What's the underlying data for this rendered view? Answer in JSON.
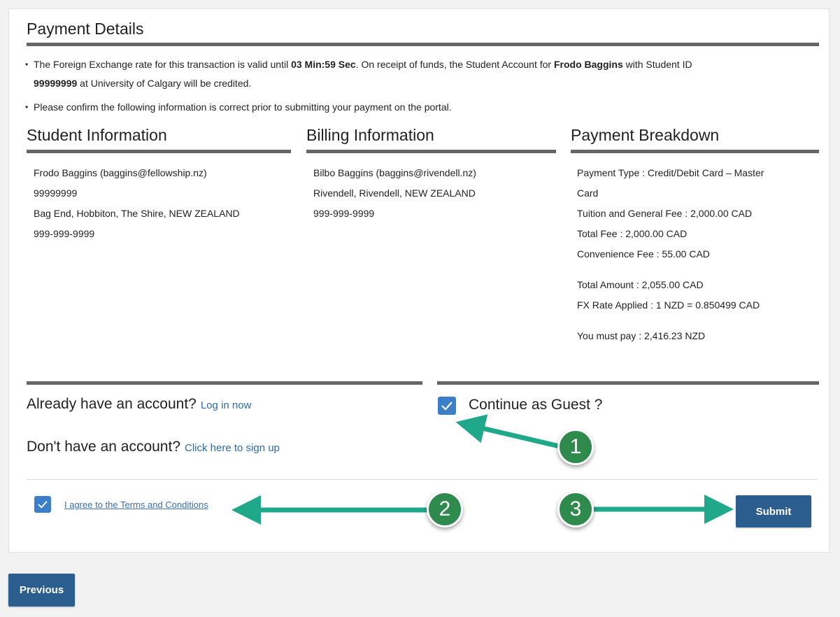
{
  "payment_details": {
    "title": "Payment Details",
    "bullet1": {
      "part1": "The Foreign Exchange rate for this transaction is valid until ",
      "timer": "03 Min:59 Sec",
      "part2": ". On receipt of funds, the Student Account for ",
      "name": "Frodo Baggins",
      "part3": " with Student ID",
      "student_id": "99999999",
      "part4": " at University of Calgary will be credited."
    },
    "bullet2": "Please confirm the following information is correct prior to submitting your payment on the portal."
  },
  "student_info": {
    "title": "Student Information",
    "lines": [
      "Frodo Baggins (baggins@fellowship.nz)",
      "99999999",
      "Bag End, Hobbiton, The Shire, NEW ZEALAND",
      "999-999-9999"
    ]
  },
  "billing_info": {
    "title": "Billing Information",
    "lines": [
      "Bilbo Baggins (baggins@rivendell.nz)",
      "Rivendell, Rivendell, NEW ZEALAND",
      "999-999-9999"
    ]
  },
  "payment_breakdown": {
    "title": "Payment Breakdown",
    "payment_type_1": "Payment Type : Credit/Debit Card – Master",
    "payment_type_2": "Card",
    "tuition": "Tuition and General Fee : 2,000.00 CAD",
    "total_fee": "Total Fee : 2,000.00 CAD",
    "convenience_fee": "Convenience Fee : 55.00 CAD",
    "total_amount": "Total Amount : 2,055.00 CAD",
    "fx_rate": "FX Rate Applied : 1 NZD = 0.850499 CAD",
    "must_pay": "You must pay : 2,416.23 NZD"
  },
  "account": {
    "have_account": "Already have an account?",
    "login_link": "Log in now",
    "no_account": "Don't have an account?",
    "signup_link": "Click here to sign up",
    "guest_label": "Continue as Guest ?",
    "guest_checked": true
  },
  "terms": {
    "label": "I agree to the Terms and Conditions",
    "checked": true
  },
  "buttons": {
    "submit": "Submit",
    "previous": "Previous"
  },
  "callouts": [
    "1",
    "2",
    "3"
  ],
  "colors": {
    "accent": "#3a7fc8",
    "button": "#2b5d8f",
    "callout": "#2f8a4e",
    "arrow": "#1fa889"
  }
}
